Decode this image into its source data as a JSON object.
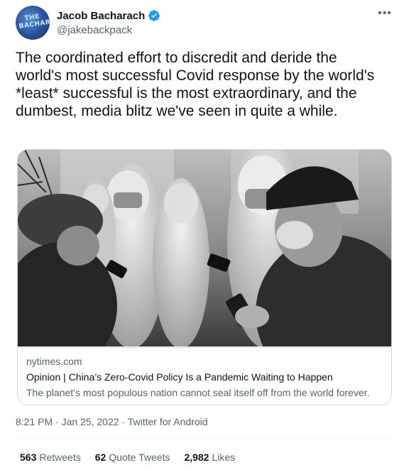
{
  "author": {
    "display_name": "Jacob Bacharach",
    "handle": "@jakebackpack",
    "avatar_text": "THE BACHARACH"
  },
  "tweet_text": "The coordinated effort to discredit and deride the world's most successful Covid response by the world's *least* successful is the most extraordinary, and the dumbest, media blitz we've seen in quite a while.",
  "card": {
    "domain": "nytimes.com",
    "title": "Opinion | China’s Zero-Covid Policy Is a Pandemic Waiting to Happen",
    "description": "The planet’s most populous nation cannot seal itself off from the world forever."
  },
  "meta": {
    "timestamp": "8:21 PM · Jan 25, 2022 · Twitter for Android"
  },
  "stats": {
    "retweets_count": "563",
    "retweets_label": "Retweets",
    "quotes_count": "62",
    "quotes_label": "Quote Tweets",
    "likes_count": "2,982",
    "likes_label": "Likes"
  },
  "colors": {
    "verified": "#1d9bf0",
    "secondary_text": "#536471",
    "border": "#cfd9de"
  },
  "icons": {
    "verified": "verified-badge-icon",
    "more": "more-horizontal-icon"
  }
}
